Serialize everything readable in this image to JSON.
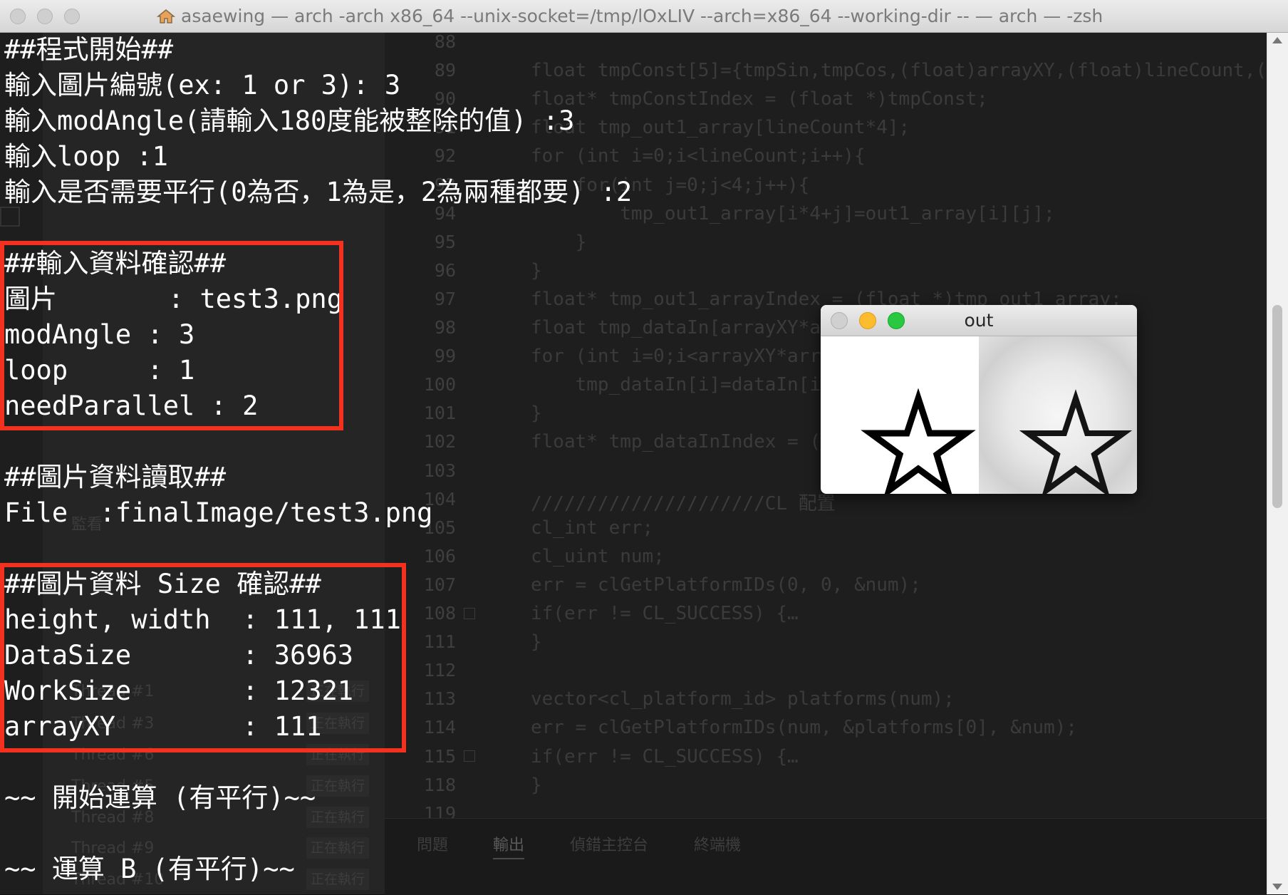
{
  "window": {
    "title": "asaewing — arch -arch x86_64  --unix-socket=/tmp/lOxLIV --arch=x86_64 --working-dir   -- — arch — -zsh"
  },
  "terminal": {
    "lines": [
      "##程式開始##",
      "輸入圖片編號(ex: 1 or 3): 3",
      "輸入modAngle(請輸入180度能被整除的值) :3",
      "輸入loop :1",
      "輸入是否需要平行(0為否，1為是，2為兩種都要) :2",
      "##輸入資料確認##",
      "圖片       : test3.png",
      "modAngle : 3",
      "loop     : 1",
      "needParallel : 2",
      "##圖片資料讀取##",
      "File  :finalImage/test3.png",
      "##圖片資料 Size 確認##",
      "height, width  : 111, 111",
      "DataSize       : 36963",
      "WorkSize       : 12321",
      "arrayXY        : 111",
      "~~ 開始運算 (有平行)~~",
      "~~ 運算 B (有平行)~~"
    ]
  },
  "ide": {
    "side_items": [
      "監看",
      "Thread #1",
      "Thread #3",
      "Thread #6",
      "Thread #5",
      "Thread #8",
      "Thread #9",
      "Thread #10"
    ],
    "side_badge": "正在執行",
    "line_numbers": [
      "88",
      "89",
      "90",
      "91",
      "92",
      "93",
      "94",
      "95",
      "96",
      "97",
      "98",
      "99",
      "100",
      "101",
      "102",
      "103",
      "104",
      "105",
      "106",
      "107",
      "108",
      "111",
      "112",
      "113",
      "114",
      "115",
      "118",
      "119"
    ],
    "code_lines": [
      "",
      "float tmpConst[5]={tmpSin,tmpCos,(float)arrayXY,(float)lineCount,(",
      "float* tmpConstIndex = (float *)tmpConst;",
      "float tmp_out1_array[lineCount*4];",
      "for (int i=0;i<lineCount;i++){",
      "    for(int j=0;j<4;j++){",
      "        tmp_out1_array[i*4+j]=out1_array[i][j];",
      "    }",
      "}",
      "float* tmp_out1_arrayIndex = (float *)tmp_out1_array;",
      "float tmp_dataIn[arrayXY*a",
      "for (int i=0;i<arrayXY*arr",
      "    tmp_dataIn[i]=dataIn[i",
      "}",
      "float* tmp_dataInIndex = (",
      "",
      "/////////////////////CL 配置",
      "cl_int err;",
      "cl_uint num;",
      "err = clGetPlatformIDs(0, 0, &num);",
      "if(err != CL_SUCCESS) {…",
      "}",
      "",
      "vector<cl_platform_id> platforms(num);",
      "err = clGetPlatformIDs(num, &platforms[0], &num);",
      "if(err != CL_SUCCESS) {…",
      "}",
      ""
    ],
    "panel_tabs": [
      "問題",
      "輸出",
      "偵錯主控台",
      "終端機"
    ]
  },
  "out_window": {
    "title": "out"
  },
  "colors": {
    "highlight_box": "#f4311f",
    "terminal_text": "#ffffff",
    "traffic_close": "#fc5f57",
    "traffic_min": "#fdbc2e",
    "traffic_max": "#29c840"
  }
}
